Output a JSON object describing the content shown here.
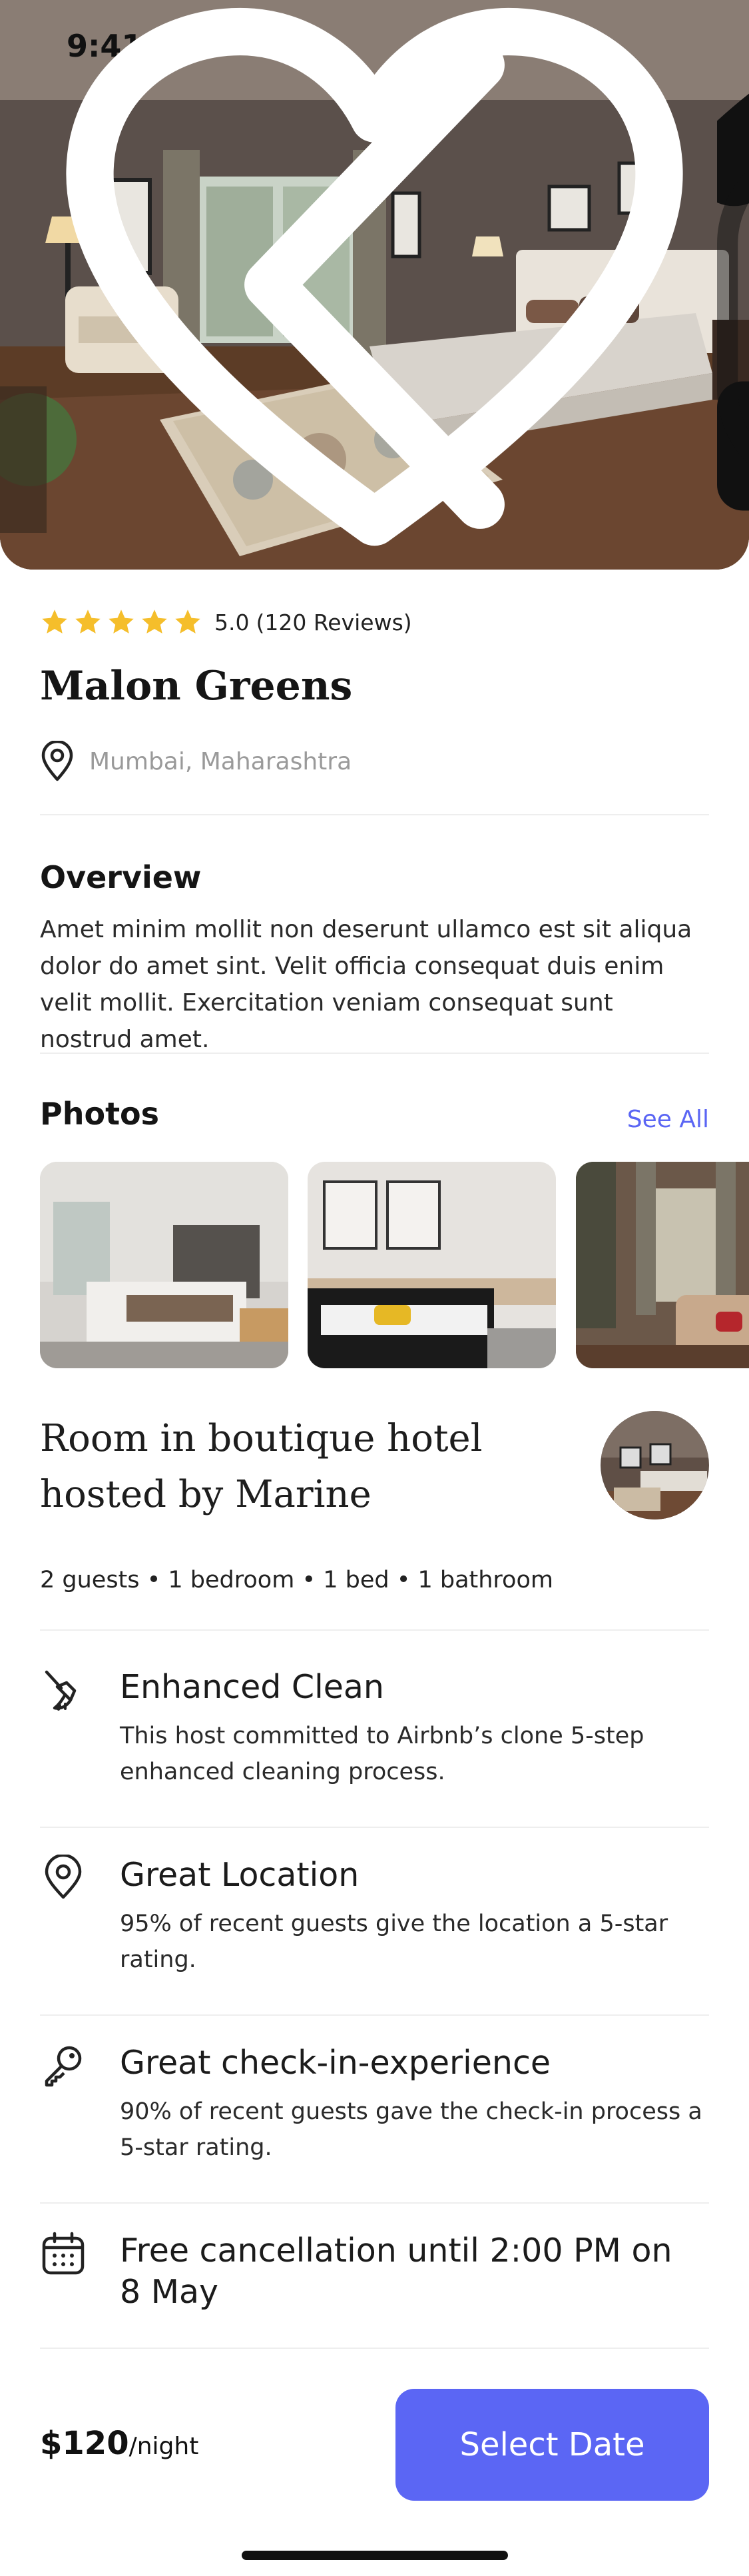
{
  "status_bar": {
    "time": "9:41"
  },
  "hotel": {
    "rating": "5.0",
    "reviews": "(120 Reviews)",
    "name": "Malon Greens",
    "location": "Mumbai, Maharashtra",
    "stars": 5
  },
  "overview": {
    "heading": "Overview",
    "text": "Amet minim mollit non deserunt ullamco est sit aliqua dolor do amet sint. Velit officia consequat duis enim velit mollit. Exercitation veniam consequat sunt nostrud amet."
  },
  "photos": {
    "heading": "Photos",
    "see_all": "See All"
  },
  "host": {
    "line1": "Room in boutique hotel",
    "line2": "hosted by Marine",
    "facts": "2 guests • 1 bedroom • 1 bed • 1 bathroom"
  },
  "features": [
    {
      "icon": "broom-icon",
      "title": "Enhanced Clean",
      "desc": "This host committed to Airbnb’s clone 5-step enhanced cleaning process."
    },
    {
      "icon": "location-pin-icon",
      "title": "Great Location",
      "desc": "95% of recent guests give the location a 5-star rating."
    },
    {
      "icon": "key-icon",
      "title": "Great check-in-experience",
      "desc": "90% of recent guests gave the check-in process a 5-star rating."
    },
    {
      "icon": "calendar-icon",
      "title": "Free cancellation until 2:00 PM on 8 May",
      "desc": ""
    }
  ],
  "footer": {
    "price": "$120",
    "unit": "/night",
    "button": "Select Date"
  },
  "colors": {
    "accent": "#5b66f4",
    "star": "#f5be2b",
    "muted": "#9a9a9a"
  }
}
